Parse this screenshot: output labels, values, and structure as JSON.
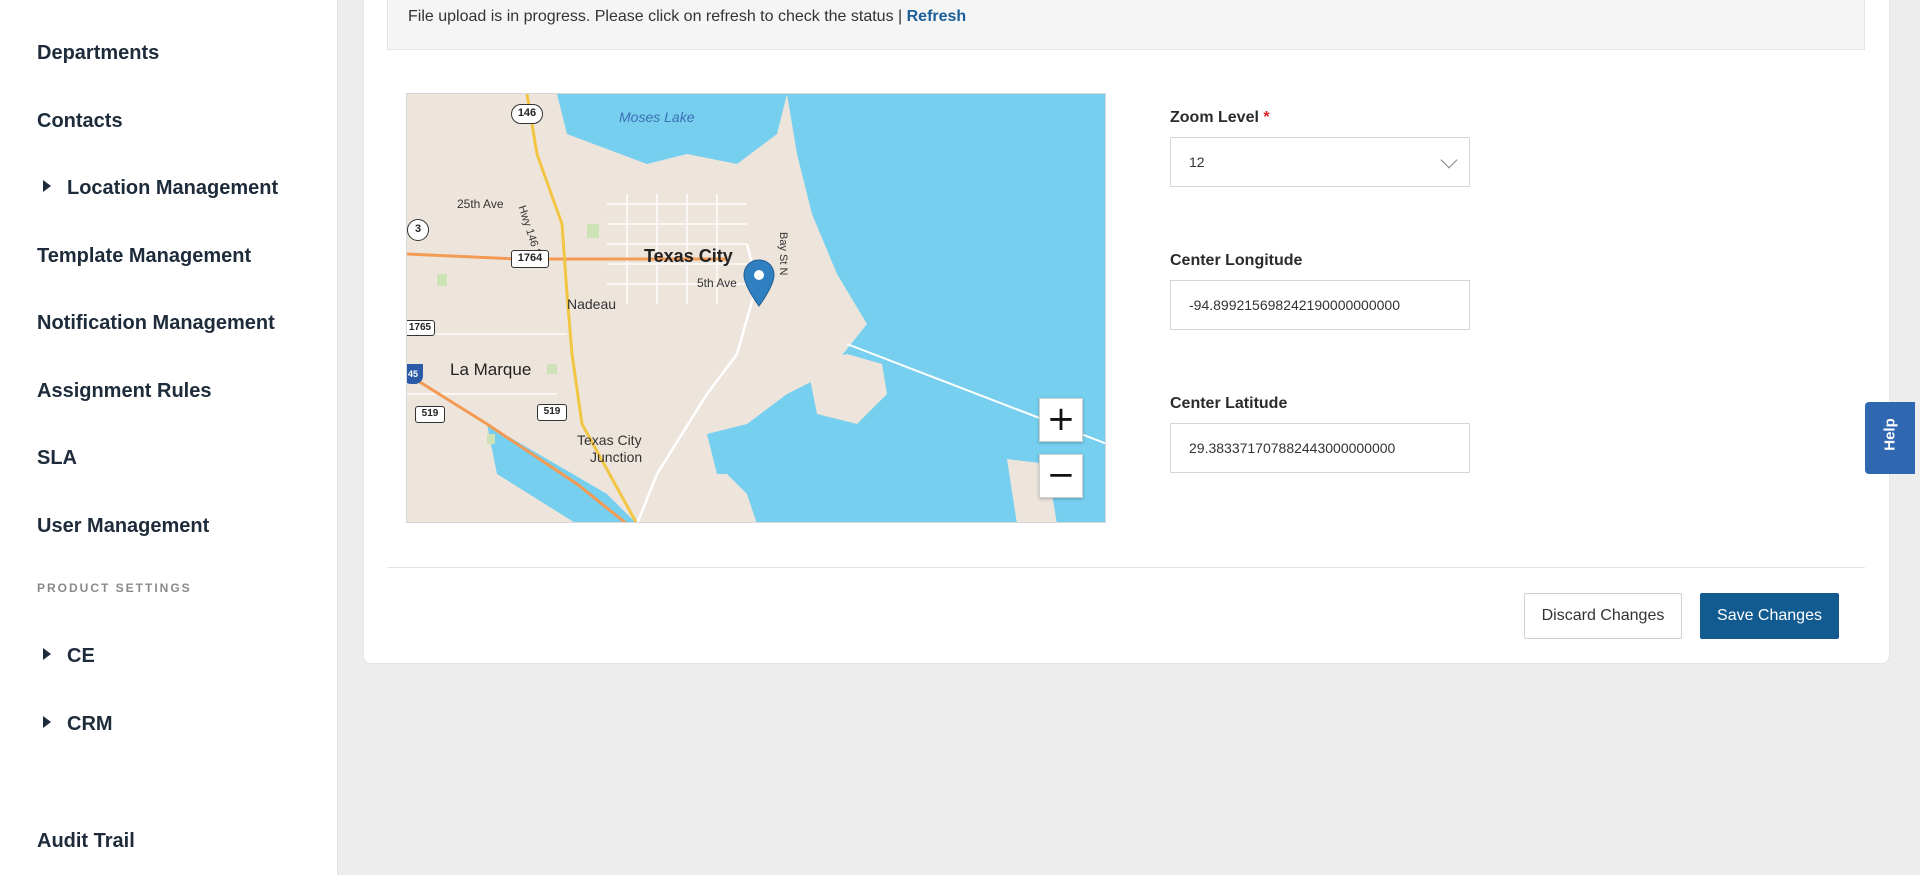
{
  "sidebar": {
    "items": [
      {
        "label": "Departments"
      },
      {
        "label": "Contacts"
      },
      {
        "label": "Location Management"
      },
      {
        "label": "Template Management"
      },
      {
        "label": "Notification Management"
      },
      {
        "label": "Assignment Rules"
      },
      {
        "label": "SLA"
      },
      {
        "label": "User Management"
      }
    ],
    "section_label": "PRODUCT SETTINGS",
    "product_items": [
      {
        "label": "CE"
      },
      {
        "label": "CRM"
      }
    ],
    "audit_trail": "Audit Trail"
  },
  "banner": {
    "message": "File upload is in progress. Please click on refresh to check the status |",
    "refresh_link": "Refresh"
  },
  "map": {
    "labels": {
      "moses_lake": "Moses Lake",
      "texas_city": "Texas City",
      "ave25": "25th Ave",
      "ave5": "5th Ave",
      "nadeau": "Nadeau",
      "la_marque": "La Marque",
      "tc_junction_1": "Texas City",
      "tc_junction_2": "Junction",
      "hwy146": "Hwy 146 N",
      "bay_st": "Bay St N",
      "shield_146": "146",
      "shield_3": "3",
      "shield_1764": "1764",
      "shield_1765": "1765",
      "shield_519a": "519",
      "shield_519b": "519",
      "shield_i45": "45"
    },
    "zoom_in": "+",
    "zoom_out": "−",
    "water_color": "#76cfee",
    "land_color": "#ede5dc",
    "marker_color": "#2f7fc1"
  },
  "form": {
    "zoom_level": {
      "label": "Zoom Level",
      "required_mark": "*",
      "value": "12"
    },
    "center_longitude": {
      "label": "Center Longitude",
      "value": "-94.899215698242190000000000"
    },
    "center_latitude": {
      "label": "Center Latitude",
      "value": "29.383371707882443000000000"
    }
  },
  "actions": {
    "discard": "Discard Changes",
    "save": "Save Changes"
  },
  "help_tab": "Help"
}
